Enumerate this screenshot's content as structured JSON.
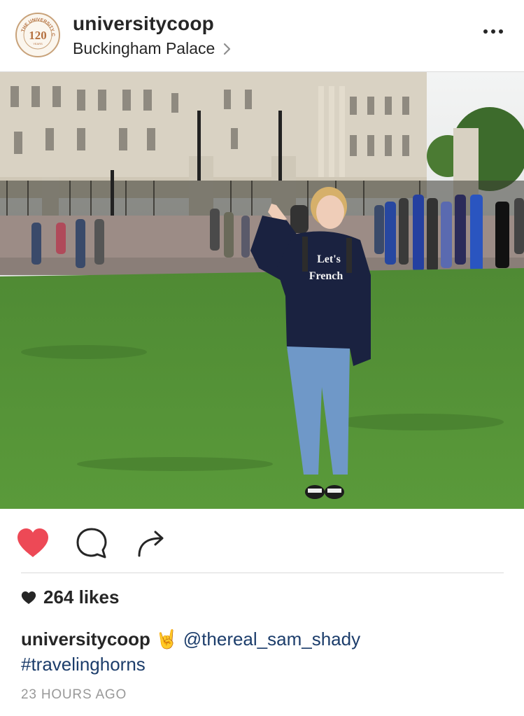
{
  "post": {
    "username": "universitycoop",
    "location": "Buckingham Palace",
    "avatar_text": "120",
    "avatar_ring_text": "THE UNIVERSITY CO-OP",
    "avatar_sub_text": "YEARS",
    "photo": {
      "shirt_text_line1": "Let's",
      "shirt_text_line2": "French"
    },
    "likes_count": "264 likes",
    "caption": {
      "username": "universitycoop",
      "emoji": "🤘",
      "mention": "@thereal_sam_shady",
      "hashtag": "#travelinghorns"
    },
    "time_ago": "23 HOURS AGO"
  },
  "icons": {
    "more": "more-horizontal-icon",
    "chevron": "chevron-right-icon",
    "like": "heart-filled-icon",
    "comment": "comment-bubble-icon",
    "share": "share-arrow-icon",
    "likes": "small-heart-icon"
  },
  "colors": {
    "like_red": "#ed4956",
    "link_blue": "#1c3d6b",
    "text": "#262626",
    "muted": "#999999",
    "divider": "#dbdbdb"
  }
}
